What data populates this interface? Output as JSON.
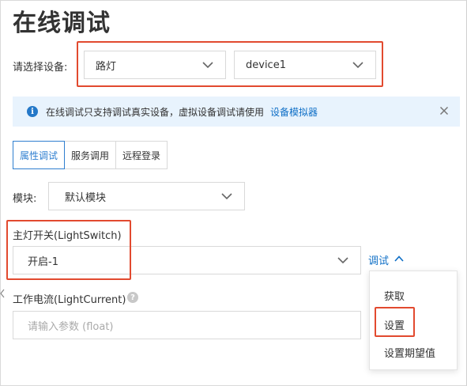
{
  "page": {
    "title": "在线调试"
  },
  "device_select": {
    "label": "请选择设备:",
    "product_value": "路灯",
    "device_value": "device1"
  },
  "notice": {
    "text": "在线调试只支持调试真实设备，虚拟设备调试请使用",
    "link": "设备模拟器"
  },
  "tabs": [
    {
      "label": "属性调试",
      "active": true
    },
    {
      "label": "服务调用",
      "active": false
    },
    {
      "label": "远程登录",
      "active": false
    }
  ],
  "module": {
    "label": "模块:",
    "value": "默认模块"
  },
  "light_switch": {
    "label": "主灯开关(LightSwitch)",
    "value": "开启-1"
  },
  "debug_link": {
    "label": "调试"
  },
  "light_current": {
    "label": "工作电流(LightCurrent)",
    "placeholder": "请输入参数 (float)"
  },
  "debug_menu": {
    "items": [
      "获取",
      "设置",
      "设置期望值"
    ]
  },
  "colors": {
    "accent": "#0f6fc6",
    "highlight": "#e24a2f",
    "notice_bg": "#e8f3fd"
  }
}
